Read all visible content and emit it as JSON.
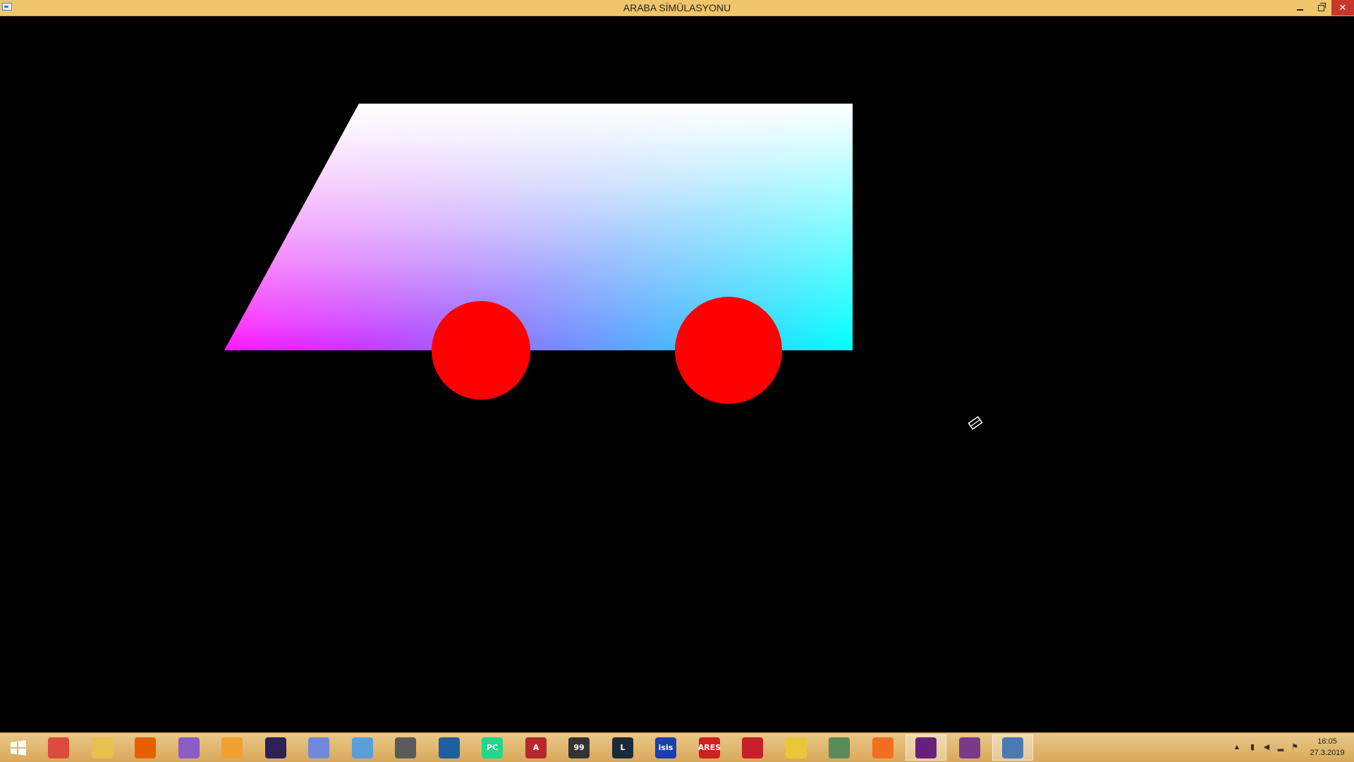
{
  "window": {
    "title": "ARABA SİMÜLASYONU",
    "minimize_glyph": "minimize",
    "maximize_glyph": "restore",
    "close_glyph": "✕"
  },
  "scene": {
    "background": "#000000",
    "car_body": {
      "type": "gradient-quadrilateral",
      "colors": {
        "top_left": "#ffffff",
        "top_right": "#ffffff",
        "bottom_left": "#ff00ff",
        "bottom_right": "#00ffff"
      }
    },
    "wheels": [
      {
        "name": "rear-wheel",
        "color": "#ff0000"
      },
      {
        "name": "front-wheel",
        "color": "#ff0000"
      }
    ]
  },
  "taskbar": {
    "items": [
      {
        "name": "chrome-icon",
        "label": "",
        "color": "#dd4b3e"
      },
      {
        "name": "file-explorer-icon",
        "label": "",
        "color": "#e8c050"
      },
      {
        "name": "firefox-icon",
        "label": "",
        "color": "#e66000"
      },
      {
        "name": "visual-studio-code-icon",
        "label": "",
        "color": "#8a5cc6"
      },
      {
        "name": "media-player-icon",
        "label": "",
        "color": "#f0a030"
      },
      {
        "name": "eclipse-icon",
        "label": "",
        "color": "#2c2255"
      },
      {
        "name": "discord-icon",
        "label": "",
        "color": "#7289da"
      },
      {
        "name": "box-app-icon",
        "label": "",
        "color": "#5aa0d8"
      },
      {
        "name": "opera-icon",
        "label": "",
        "color": "#5a5a5a"
      },
      {
        "name": "virtualbox-icon",
        "label": "",
        "color": "#1f5fa0"
      },
      {
        "name": "pycharm-icon",
        "label": "PC",
        "color": "#21d789"
      },
      {
        "name": "access-icon",
        "label": "A",
        "color": "#b7282e"
      },
      {
        "name": "terminal-99-icon",
        "label": "99",
        "color": "#333333"
      },
      {
        "name": "league-of-legends-icon",
        "label": "L",
        "color": "#1a2a3a"
      },
      {
        "name": "isis-icon",
        "label": "isis",
        "color": "#1a3fb0"
      },
      {
        "name": "ares-icon",
        "label": "ARES",
        "color": "#d02020"
      },
      {
        "name": "mplab-icon",
        "label": "",
        "color": "#c81f2a"
      },
      {
        "name": "database-icon",
        "label": "",
        "color": "#e8c838"
      },
      {
        "name": "settings-tool-icon",
        "label": "",
        "color": "#5a8a5a"
      },
      {
        "name": "paint-icon",
        "label": "",
        "color": "#f07020"
      },
      {
        "name": "visual-studio-icon",
        "label": "",
        "color": "#68217a",
        "active": true
      },
      {
        "name": "winrar-icon",
        "label": "",
        "color": "#7a3a8a"
      },
      {
        "name": "running-app-icon",
        "label": "",
        "color": "#4a7ab0",
        "active": true
      }
    ]
  },
  "tray": {
    "time": "16:05",
    "date": "27.3.2019"
  }
}
